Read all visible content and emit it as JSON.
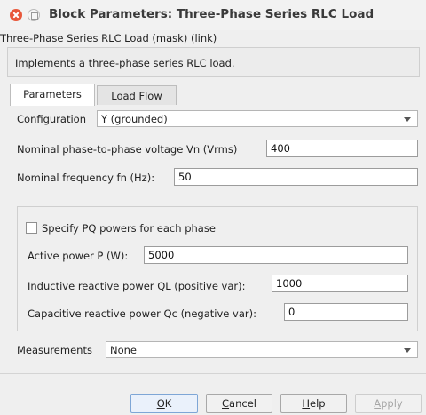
{
  "window": {
    "title": "Block Parameters: Three-Phase Series RLC Load"
  },
  "mask_line": "Three-Phase Series RLC Load (mask) (link)",
  "description": "Implements a three-phase series RLC load.",
  "tabs": [
    {
      "label": "Parameters",
      "active": true
    },
    {
      "label": "Load Flow",
      "active": false
    }
  ],
  "params": {
    "configuration": {
      "label": "Configuration",
      "value": "Y (grounded)"
    },
    "voltage": {
      "label": "Nominal phase-to-phase voltage Vn (Vrms)",
      "value": "400"
    },
    "frequency": {
      "label": "Nominal frequency fn (Hz):",
      "value": "50"
    },
    "pq": {
      "label": "Specify PQ powers for each phase",
      "checked": false
    },
    "active_power": {
      "label": "Active power P (W):",
      "value": "5000"
    },
    "inductive_power": {
      "label": "Inductive reactive power QL (positive var):",
      "value": "1000"
    },
    "capacitive_power": {
      "label": "Capacitive reactive power Qc (negative var):",
      "value": "0"
    },
    "measurements": {
      "label": "Measurements",
      "value": "None"
    }
  },
  "buttons": {
    "ok": {
      "mnemonic": "O",
      "rest": "K"
    },
    "cancel": {
      "mnemonic": "C",
      "rest": "ancel"
    },
    "help": {
      "mnemonic": "H",
      "rest": "elp"
    },
    "apply": {
      "mnemonic": "A",
      "rest": "pply"
    }
  },
  "colors": {
    "close_button": "#e8573a",
    "ok_border": "#7ea6d6"
  },
  "icons": [
    "close-icon",
    "minimize-icon",
    "chevron-down-icon"
  ]
}
